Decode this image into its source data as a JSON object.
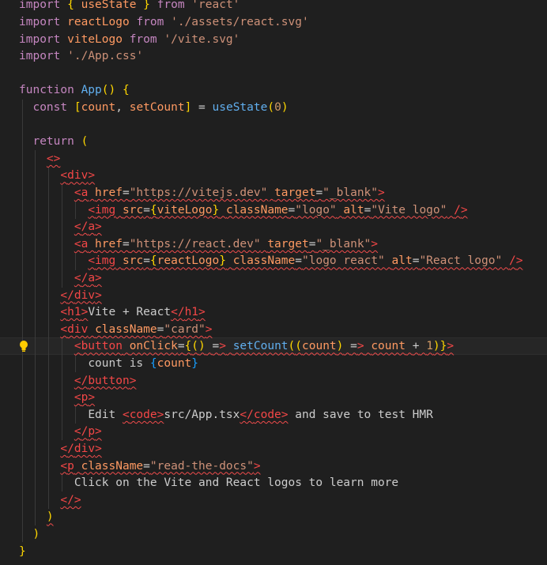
{
  "editor": {
    "language": "tsx",
    "theme_colors": {
      "background": "#1f1f1f",
      "keyword": "#c586c0",
      "string": "#ce9178",
      "tag": "#f44747",
      "attribute": "#ff9a62",
      "function": "#61afef",
      "bracket": "#ffd700",
      "error_squiggle": "#f14c4c"
    },
    "lightbulb_icon": "lightbulb-icon",
    "lines": [
      "import { useState } from 'react'",
      "import reactLogo from './assets/react.svg'",
      "import viteLogo from '/vite.svg'",
      "import './App.css'",
      "",
      "function App() {",
      "  const [count, setCount] = useState(0)",
      "",
      "  return (",
      "    <>",
      "      <div>",
      "        <a href=\"https://vitejs.dev\" target=\"_blank\">",
      "          <img src={viteLogo} className=\"logo\" alt=\"Vite logo\" />",
      "        </a>",
      "        <a href=\"https://react.dev\" target=\"_blank\">",
      "          <img src={reactLogo} className=\"logo react\" alt=\"React logo\" />",
      "        </a>",
      "      </div>",
      "      <h1>Vite + React</h1>",
      "      <div className=\"card\">",
      "        <button onClick={() => setCount((count) => count + 1)}>",
      "          count is {count}",
      "        </button>",
      "        <p>",
      "          Edit <code>src/App.tsx</code> and save to test HMR",
      "        </p>",
      "      </div>",
      "      <p className=\"read-the-docs\">",
      "        Click on the Vite and React logos to learn more",
      "      </p>",
      "    </>",
      "  )",
      "}"
    ]
  }
}
